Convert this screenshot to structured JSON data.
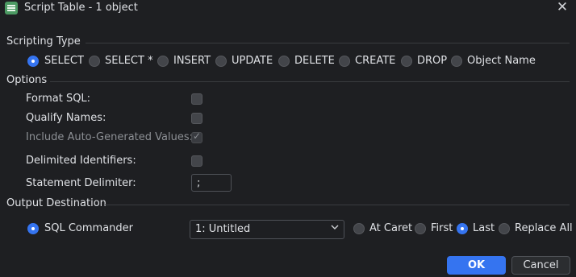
{
  "window": {
    "title": "Script Table - 1 object"
  },
  "scripting_type": {
    "heading": "Scripting Type",
    "options": [
      "SELECT",
      "SELECT *",
      "INSERT",
      "UPDATE",
      "DELETE",
      "CREATE",
      "DROP",
      "Object Name"
    ],
    "selected": "SELECT"
  },
  "options": {
    "heading": "Options",
    "format_sql": {
      "label": "Format SQL:",
      "checked": false
    },
    "qualify_names": {
      "label": "Qualify Names:",
      "checked": false
    },
    "include_auto": {
      "label": "Include Auto-Generated Values:",
      "checked": true,
      "disabled": true
    },
    "delimited_identifiers": {
      "label": "Delimited Identifiers:",
      "checked": false
    },
    "statement_delimiter": {
      "label": "Statement Delimiter:",
      "value": ";"
    }
  },
  "output": {
    "heading": "Output Destination",
    "destination_label": "SQL Commander",
    "commander_select": "1: Untitled",
    "positions": [
      "At Caret",
      "First",
      "Last",
      "Replace All"
    ],
    "selected_position": "Last"
  },
  "buttons": {
    "ok": "OK",
    "cancel": "Cancel"
  },
  "colors": {
    "accent": "#3574f0",
    "background": "#1e1f22"
  }
}
